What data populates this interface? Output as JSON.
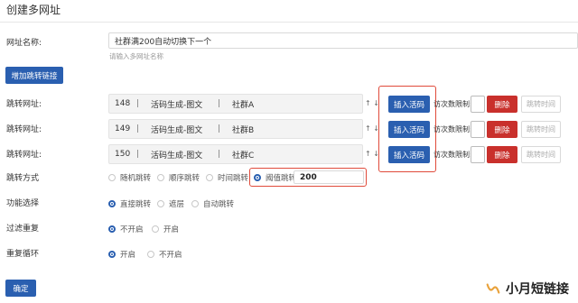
{
  "page_title": "创建多网址",
  "form": {
    "name_label": "网址名称:",
    "name_value": "社群满200自动切换下一个",
    "name_hint": "请输入多网址名称",
    "add_button": "增加跳转链接",
    "jump_label": "跳转网址:",
    "rows": [
      {
        "id": "148",
        "sep1": "|",
        "type": "活码生成-图文",
        "sep2": "|",
        "name": "社群A",
        "move": "↑ ↓"
      },
      {
        "id": "149",
        "sep1": "|",
        "type": "活码生成-图文",
        "sep2": "|",
        "name": "社群B",
        "move": "↑ ↓"
      },
      {
        "id": "150",
        "sep1": "|",
        "type": "活码生成-图文",
        "sep2": "|",
        "name": "社群C",
        "move": "↑ ↓"
      }
    ],
    "insert_label": "插入活码",
    "limit_label": "访次数限制:",
    "delete_label": "删除",
    "jump_time_label": "跳转时间",
    "jump_mode_label": "跳转方式",
    "jump_modes": [
      "随机跳转",
      "顺序跳转",
      "时间跳转",
      "阈值跳转"
    ],
    "threshold_value": "200",
    "function_label": "功能选择",
    "functions": [
      "直接跳转",
      "遮层",
      "自动跳转"
    ],
    "filter_label": "过滤重复",
    "filter_options": [
      "不开启",
      "开启"
    ],
    "loop_label": "重复循环",
    "loop_options": [
      "开启",
      "不开启"
    ],
    "submit_label": "确定"
  },
  "watermark": {
    "text": "小月短链接",
    "icon": "wechat-channel-icon"
  },
  "colors": {
    "primary": "#2a5fb0",
    "danger": "#c9302c",
    "highlight": "#e04a3a"
  }
}
